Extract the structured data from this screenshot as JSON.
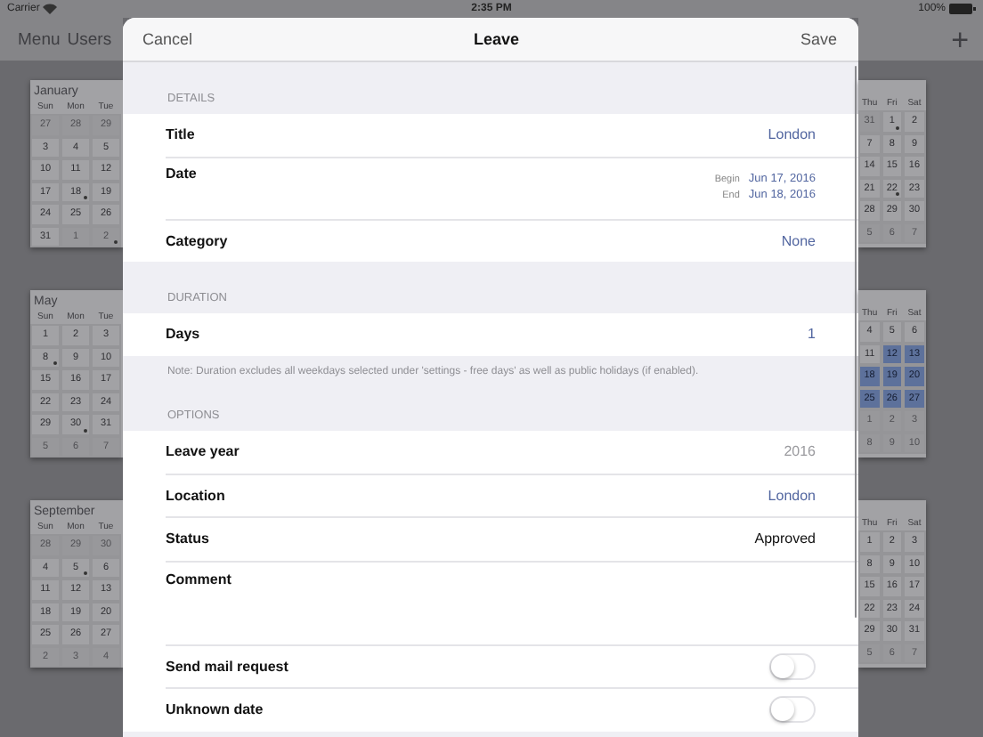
{
  "status_bar": {
    "carrier": "Carrier",
    "time": "2:35 PM",
    "battery": "100%"
  },
  "nav": {
    "items": [
      "Menu",
      "Users"
    ],
    "add": "+"
  },
  "left_cards": [
    {
      "month": "January",
      "weekdays": [
        "Sun",
        "Mon",
        "Tue"
      ],
      "weeks": [
        [
          {
            "day": "27",
            "other": true,
            "selected": false,
            "marked": false
          },
          {
            "day": "28",
            "other": true,
            "selected": false,
            "marked": false
          },
          {
            "day": "29",
            "other": true,
            "selected": false,
            "marked": false
          }
        ],
        [
          {
            "day": "3",
            "other": false,
            "selected": false,
            "marked": false
          },
          {
            "day": "4",
            "other": false,
            "selected": false,
            "marked": false
          },
          {
            "day": "5",
            "other": false,
            "selected": false,
            "marked": false
          }
        ],
        [
          {
            "day": "10",
            "other": false,
            "selected": false,
            "marked": false
          },
          {
            "day": "11",
            "other": false,
            "selected": false,
            "marked": false
          },
          {
            "day": "12",
            "other": false,
            "selected": false,
            "marked": false
          }
        ],
        [
          {
            "day": "17",
            "other": false,
            "selected": false,
            "marked": false
          },
          {
            "day": "18",
            "other": false,
            "selected": false,
            "marked": true
          },
          {
            "day": "19",
            "other": false,
            "selected": false,
            "marked": false
          }
        ],
        [
          {
            "day": "24",
            "other": false,
            "selected": false,
            "marked": false
          },
          {
            "day": "25",
            "other": false,
            "selected": false,
            "marked": false
          },
          {
            "day": "26",
            "other": false,
            "selected": false,
            "marked": false
          }
        ],
        [
          {
            "day": "31",
            "other": false,
            "selected": false,
            "marked": false
          },
          {
            "day": "1",
            "other": true,
            "selected": false,
            "marked": false
          },
          {
            "day": "2",
            "other": true,
            "selected": false,
            "marked": true
          }
        ]
      ]
    },
    {
      "month": "May",
      "weekdays": [
        "Sun",
        "Mon",
        "Tue"
      ],
      "weeks": [
        [
          {
            "day": "1",
            "other": false,
            "selected": false,
            "marked": false
          },
          {
            "day": "2",
            "other": false,
            "selected": false,
            "marked": false
          },
          {
            "day": "3",
            "other": false,
            "selected": false,
            "marked": false
          }
        ],
        [
          {
            "day": "8",
            "other": false,
            "selected": false,
            "marked": true
          },
          {
            "day": "9",
            "other": false,
            "selected": false,
            "marked": false
          },
          {
            "day": "10",
            "other": false,
            "selected": false,
            "marked": false
          }
        ],
        [
          {
            "day": "15",
            "other": false,
            "selected": false,
            "marked": false
          },
          {
            "day": "16",
            "other": false,
            "selected": false,
            "marked": false
          },
          {
            "day": "17",
            "other": false,
            "selected": false,
            "marked": false
          }
        ],
        [
          {
            "day": "22",
            "other": false,
            "selected": false,
            "marked": false
          },
          {
            "day": "23",
            "other": false,
            "selected": false,
            "marked": false
          },
          {
            "day": "24",
            "other": false,
            "selected": false,
            "marked": false
          }
        ],
        [
          {
            "day": "29",
            "other": false,
            "selected": false,
            "marked": false
          },
          {
            "day": "30",
            "other": false,
            "selected": false,
            "marked": true
          },
          {
            "day": "31",
            "other": false,
            "selected": false,
            "marked": false
          }
        ],
        [
          {
            "day": "5",
            "other": true,
            "selected": false,
            "marked": false
          },
          {
            "day": "6",
            "other": true,
            "selected": false,
            "marked": false
          },
          {
            "day": "7",
            "other": true,
            "selected": false,
            "marked": false
          }
        ]
      ]
    },
    {
      "month": "September",
      "weekdays": [
        "Sun",
        "Mon",
        "Tue"
      ],
      "weeks": [
        [
          {
            "day": "28",
            "other": true,
            "selected": false,
            "marked": false
          },
          {
            "day": "29",
            "other": true,
            "selected": false,
            "marked": false
          },
          {
            "day": "30",
            "other": true,
            "selected": false,
            "marked": false
          }
        ],
        [
          {
            "day": "4",
            "other": false,
            "selected": false,
            "marked": false
          },
          {
            "day": "5",
            "other": false,
            "selected": false,
            "marked": true
          },
          {
            "day": "6",
            "other": false,
            "selected": false,
            "marked": false
          }
        ],
        [
          {
            "day": "11",
            "other": false,
            "selected": false,
            "marked": false
          },
          {
            "day": "12",
            "other": false,
            "selected": false,
            "marked": false
          },
          {
            "day": "13",
            "other": false,
            "selected": false,
            "marked": false
          }
        ],
        [
          {
            "day": "18",
            "other": false,
            "selected": false,
            "marked": false
          },
          {
            "day": "19",
            "other": false,
            "selected": false,
            "marked": false
          },
          {
            "day": "20",
            "other": false,
            "selected": false,
            "marked": false
          }
        ],
        [
          {
            "day": "25",
            "other": false,
            "selected": false,
            "marked": false
          },
          {
            "day": "26",
            "other": false,
            "selected": false,
            "marked": false
          },
          {
            "day": "27",
            "other": false,
            "selected": false,
            "marked": false
          }
        ],
        [
          {
            "day": "2",
            "other": true,
            "selected": false,
            "marked": false
          },
          {
            "day": "3",
            "other": true,
            "selected": false,
            "marked": false
          },
          {
            "day": "4",
            "other": true,
            "selected": false,
            "marked": false
          }
        ]
      ]
    }
  ],
  "right_cards": [
    {
      "weekdays": [
        "Thu",
        "Fri",
        "Sat"
      ],
      "weeks": [
        [
          {
            "day": "31",
            "other": true,
            "selected": false,
            "marked": false
          },
          {
            "day": "1",
            "other": false,
            "selected": false,
            "marked": true
          },
          {
            "day": "2",
            "other": false,
            "selected": false,
            "marked": false
          }
        ],
        [
          {
            "day": "7",
            "other": false,
            "selected": false,
            "marked": false
          },
          {
            "day": "8",
            "other": false,
            "selected": false,
            "marked": false
          },
          {
            "day": "9",
            "other": false,
            "selected": false,
            "marked": false
          }
        ],
        [
          {
            "day": "14",
            "other": false,
            "selected": false,
            "marked": false
          },
          {
            "day": "15",
            "other": false,
            "selected": false,
            "marked": false
          },
          {
            "day": "16",
            "other": false,
            "selected": false,
            "marked": false
          }
        ],
        [
          {
            "day": "21",
            "other": false,
            "selected": false,
            "marked": false
          },
          {
            "day": "22",
            "other": false,
            "selected": false,
            "marked": true
          },
          {
            "day": "23",
            "other": false,
            "selected": false,
            "marked": false
          }
        ],
        [
          {
            "day": "28",
            "other": false,
            "selected": false,
            "marked": false
          },
          {
            "day": "29",
            "other": false,
            "selected": false,
            "marked": false
          },
          {
            "day": "30",
            "other": false,
            "selected": false,
            "marked": false
          }
        ],
        [
          {
            "day": "5",
            "other": true,
            "selected": false,
            "marked": false
          },
          {
            "day": "6",
            "other": true,
            "selected": false,
            "marked": false
          },
          {
            "day": "7",
            "other": true,
            "selected": false,
            "marked": false
          }
        ]
      ]
    },
    {
      "weekdays": [
        "Thu",
        "Fri",
        "Sat"
      ],
      "weeks": [
        [
          {
            "day": "4",
            "other": false,
            "selected": false,
            "marked": false
          },
          {
            "day": "5",
            "other": false,
            "selected": false,
            "marked": false
          },
          {
            "day": "6",
            "other": false,
            "selected": false,
            "marked": false
          }
        ],
        [
          {
            "day": "11",
            "other": false,
            "selected": false,
            "marked": false
          },
          {
            "day": "12",
            "other": false,
            "selected": true,
            "marked": false
          },
          {
            "day": "13",
            "other": false,
            "selected": true,
            "marked": false
          }
        ],
        [
          {
            "day": "18",
            "other": false,
            "selected": true,
            "marked": false
          },
          {
            "day": "19",
            "other": false,
            "selected": true,
            "marked": false
          },
          {
            "day": "20",
            "other": false,
            "selected": true,
            "marked": false
          }
        ],
        [
          {
            "day": "25",
            "other": false,
            "selected": true,
            "marked": false
          },
          {
            "day": "26",
            "other": false,
            "selected": true,
            "marked": false
          },
          {
            "day": "27",
            "other": false,
            "selected": true,
            "marked": false
          }
        ],
        [
          {
            "day": "1",
            "other": true,
            "selected": false,
            "marked": false
          },
          {
            "day": "2",
            "other": true,
            "selected": false,
            "marked": false
          },
          {
            "day": "3",
            "other": true,
            "selected": false,
            "marked": false
          }
        ],
        [
          {
            "day": "8",
            "other": true,
            "selected": false,
            "marked": false
          },
          {
            "day": "9",
            "other": true,
            "selected": false,
            "marked": false
          },
          {
            "day": "10",
            "other": true,
            "selected": false,
            "marked": false
          }
        ]
      ]
    },
    {
      "weekdays": [
        "Thu",
        "Fri",
        "Sat"
      ],
      "weeks": [
        [
          {
            "day": "1",
            "other": false,
            "selected": false,
            "marked": false
          },
          {
            "day": "2",
            "other": false,
            "selected": false,
            "marked": false
          },
          {
            "day": "3",
            "other": false,
            "selected": false,
            "marked": false
          }
        ],
        [
          {
            "day": "8",
            "other": false,
            "selected": false,
            "marked": false
          },
          {
            "day": "9",
            "other": false,
            "selected": false,
            "marked": false
          },
          {
            "day": "10",
            "other": false,
            "selected": false,
            "marked": false
          }
        ],
        [
          {
            "day": "15",
            "other": false,
            "selected": false,
            "marked": false
          },
          {
            "day": "16",
            "other": false,
            "selected": false,
            "marked": false
          },
          {
            "day": "17",
            "other": false,
            "selected": false,
            "marked": false
          }
        ],
        [
          {
            "day": "22",
            "other": false,
            "selected": false,
            "marked": false
          },
          {
            "day": "23",
            "other": false,
            "selected": false,
            "marked": false
          },
          {
            "day": "24",
            "other": false,
            "selected": false,
            "marked": false
          }
        ],
        [
          {
            "day": "29",
            "other": false,
            "selected": false,
            "marked": false
          },
          {
            "day": "30",
            "other": false,
            "selected": false,
            "marked": false
          },
          {
            "day": "31",
            "other": false,
            "selected": false,
            "marked": false
          }
        ],
        [
          {
            "day": "5",
            "other": true,
            "selected": false,
            "marked": false
          },
          {
            "day": "6",
            "other": true,
            "selected": false,
            "marked": false
          },
          {
            "day": "7",
            "other": true,
            "selected": false,
            "marked": false
          }
        ]
      ]
    }
  ],
  "sheet": {
    "cancel": "Cancel",
    "title": "Leave",
    "save": "Save",
    "sections": [
      {
        "header": "DETAILS",
        "rows": [
          {
            "kind": "link",
            "label": "Title",
            "value": "London"
          },
          {
            "kind": "dates",
            "label": "Date",
            "dates": [
              {
                "label": "Begin",
                "value": "Jun 17, 2016"
              },
              {
                "label": "End",
                "value": "Jun 18, 2016"
              }
            ]
          },
          {
            "kind": "link",
            "label": "Category",
            "value": "None"
          }
        ]
      },
      {
        "header": "DURATION",
        "rows": [
          {
            "kind": "link",
            "label": "Days",
            "value": "1"
          }
        ],
        "footer": "Note: Duration excludes all weekdays selected under 'settings - free days' as well as public holidays (if enabled)."
      },
      {
        "header": "OPTIONS",
        "rows": [
          {
            "kind": "muted",
            "label": "Leave year",
            "value": "2016"
          },
          {
            "kind": "link",
            "label": "Location",
            "value": "London"
          },
          {
            "kind": "plain",
            "label": "Status",
            "value": "Approved"
          },
          {
            "kind": "comment",
            "label": "Comment"
          },
          {
            "kind": "toggle",
            "label": "Send mail request",
            "on": false
          },
          {
            "kind": "toggle",
            "label": "Unknown date",
            "on": false
          }
        ]
      }
    ]
  }
}
